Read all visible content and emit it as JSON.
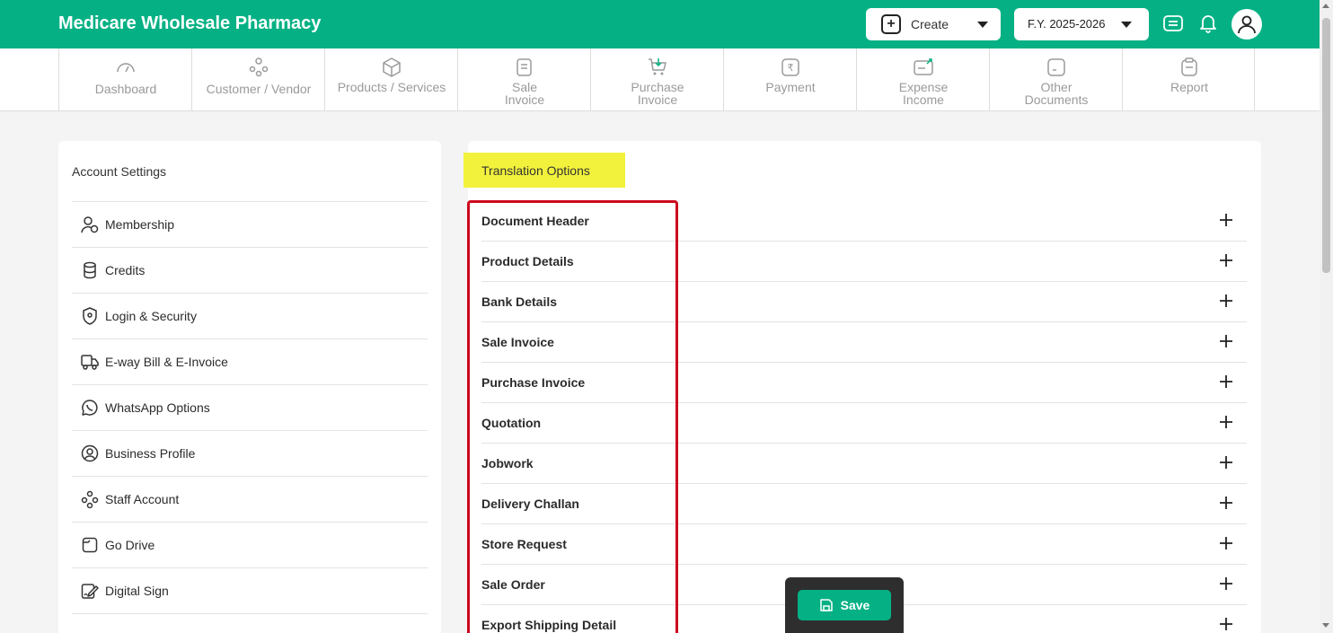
{
  "app": {
    "title": "Medicare Wholesale Pharmacy"
  },
  "topbar": {
    "create_label": "Create",
    "fy_label": "F.Y. 2025-2026"
  },
  "nav": [
    {
      "line1": "Dashboard",
      "line2": "",
      "icon": "gauge-icon"
    },
    {
      "line1": "Customer / Vendor",
      "line2": "",
      "icon": "users-icon"
    },
    {
      "line1": "Products / Services",
      "line2": "",
      "icon": "box-icon"
    },
    {
      "line1": "Sale",
      "line2": "Invoice",
      "icon": "invoice-icon"
    },
    {
      "line1": "Purchase",
      "line2": "Invoice",
      "icon": "cart-icon"
    },
    {
      "line1": "Payment",
      "line2": "",
      "icon": "rupee-icon"
    },
    {
      "line1": "Expense",
      "line2": "Income",
      "icon": "wallet-icon"
    },
    {
      "line1": "Other",
      "line2": "Documents",
      "icon": "document-icon"
    },
    {
      "line1": "Report",
      "line2": "",
      "icon": "clipboard-icon"
    }
  ],
  "settings": {
    "title": "Account Settings",
    "items": [
      {
        "label": "Membership",
        "icon": "membership-icon"
      },
      {
        "label": "Credits",
        "icon": "coins-icon"
      },
      {
        "label": "Login & Security",
        "icon": "shield-icon"
      },
      {
        "label": "E-way Bill & E-Invoice",
        "icon": "truck-icon"
      },
      {
        "label": "WhatsApp Options",
        "icon": "whatsapp-icon"
      },
      {
        "label": "Business Profile",
        "icon": "profile-icon"
      },
      {
        "label": "Staff Account",
        "icon": "staff-icon"
      },
      {
        "label": "Go Drive",
        "icon": "drive-icon"
      },
      {
        "label": "Digital Sign",
        "icon": "sign-icon"
      }
    ]
  },
  "translation": {
    "title": "Translation Options",
    "sections": [
      "Document Header",
      "Product Details",
      "Bank Details",
      "Sale Invoice",
      "Purchase Invoice",
      "Quotation",
      "Jobwork",
      "Delivery Challan",
      "Store Request",
      "Sale Order",
      "Export Shipping Detail"
    ]
  },
  "save": {
    "label": "Save"
  },
  "colors": {
    "brand": "#05b184",
    "highlight": "#f2f23c",
    "outline": "#cc0a1f"
  }
}
